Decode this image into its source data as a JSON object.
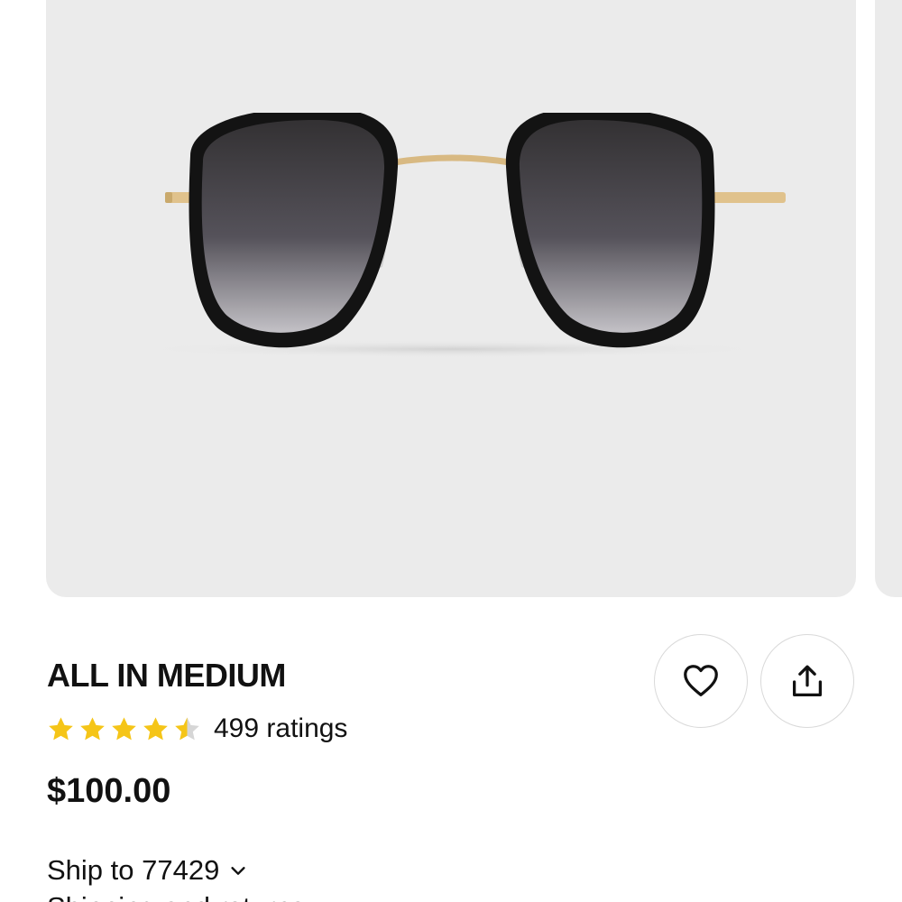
{
  "product": {
    "name": "ALL IN MEDIUM",
    "rating_value": 4.5,
    "rating_count_label": "499 ratings",
    "price": "$100.00"
  },
  "shipping": {
    "label": "Ship to 77429",
    "next_line": "Shipping and returns"
  },
  "colors": {
    "star": "#f5c518",
    "star_empty": "#d6d6d6",
    "image_bg": "#ebebeb",
    "button_border": "#d9d9d9"
  },
  "icons": {
    "favorite": "heart-icon",
    "share": "share-icon",
    "ship_dropdown": "chevron-down-icon"
  }
}
